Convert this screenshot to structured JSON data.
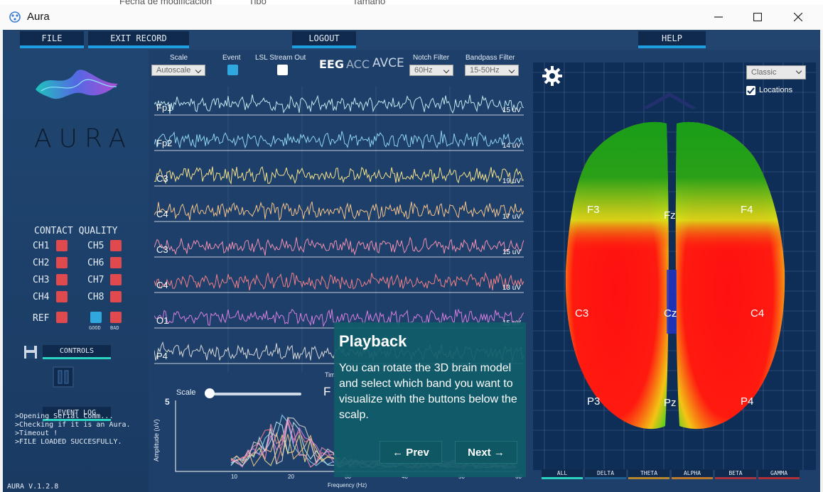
{
  "background_window": {
    "columns": [
      "Fecha de modificación",
      "Tipo",
      "Tamaño"
    ]
  },
  "window": {
    "title": "Aura",
    "minimize_icon": "minimize-icon",
    "maximize_icon": "maximize-icon",
    "close_icon": "close-icon"
  },
  "menu": {
    "file": "FILE",
    "exit_record": "EXIT RECORD",
    "logout": "LOGOUT",
    "help": "HELP"
  },
  "left_panel": {
    "brand": "AURA",
    "contact_quality_title": "CONTACT QUALITY",
    "channels": [
      "CH1",
      "CH2",
      "CH3",
      "CH4",
      "CH5",
      "CH6",
      "CH7",
      "CH8"
    ],
    "ref_label": "REF",
    "legend_good": "GOOD",
    "legend_bad": "BAD",
    "controls_label": "CONTROLS",
    "event_log_label": "EVENT LOG",
    "log_lines": [
      ">Opening Serial Comm...",
      ">Checking if it is an Aura.",
      ">Timeout !",
      ">FILE LOADED SUCCESFULLY."
    ],
    "version": "AURA V.1.2.8",
    "status_colors": {
      "bad": "#e04a4f",
      "good": "#2fa8e0"
    }
  },
  "toolbar": {
    "scale_label": "Scale",
    "scale_value": "Autoscale",
    "event_label": "Event",
    "lsl_label": "LSL Stream Out",
    "modes": [
      "EEG",
      "ACC",
      "AVCE"
    ],
    "notch_label": "Notch Filter",
    "notch_value": "60Hz",
    "bandpass_label": "Bandpass Filter",
    "bandpass_value": "15-50Hz"
  },
  "eeg": {
    "channels": [
      {
        "name": "Fp1",
        "scale": "15 uV",
        "color": "#bfe9ef"
      },
      {
        "name": "Fp2",
        "scale": "14 uV",
        "color": "#8fd3ee"
      },
      {
        "name": "C3",
        "scale": "19 uV",
        "color": "#f4e28c"
      },
      {
        "name": "C4",
        "scale": "17 uV",
        "color": "#f4c38c"
      },
      {
        "name": "C3",
        "scale": "15 uV",
        "color": "#f08fb3"
      },
      {
        "name": "C4",
        "scale": "13 uV",
        "color": "#f07f8a"
      },
      {
        "name": "O1",
        "scale": "15 uV",
        "color": "#d77ee0"
      },
      {
        "name": "P4",
        "scale": "",
        "color": "#d8d8d8"
      }
    ],
    "time_label_fragment": "Tim"
  },
  "spectrum": {
    "scale_label": "Scale",
    "title_fragment": "F",
    "y_max": "5",
    "y_label": "Amplitude (uV)",
    "x_label": "Frequency (Hz)",
    "x_ticks": [
      "10",
      "20",
      "30",
      "40",
      "50",
      "60"
    ]
  },
  "brain": {
    "view_select": "Classic",
    "locations_label": "Locations",
    "electrodes": [
      "F3",
      "Fz",
      "F4",
      "C3",
      "Cz",
      "C4",
      "P3",
      "Pz",
      "P4"
    ],
    "settings_icon": "gear-icon",
    "bands": [
      "ALL",
      "DELTA",
      "THETA",
      "ALPHA",
      "BETA",
      "GAMMA"
    ],
    "band_colors": [
      "#29d3c0",
      "#1e5f8f",
      "#b8862c",
      "#c07a2c",
      "#a8343f",
      "#b03038"
    ]
  },
  "tooltip": {
    "title": "Playback",
    "body": "You can rotate the 3D brain model and select which band you want to visualize with the buttons below the scalp.",
    "prev": "← Prev",
    "next": "Next →"
  }
}
